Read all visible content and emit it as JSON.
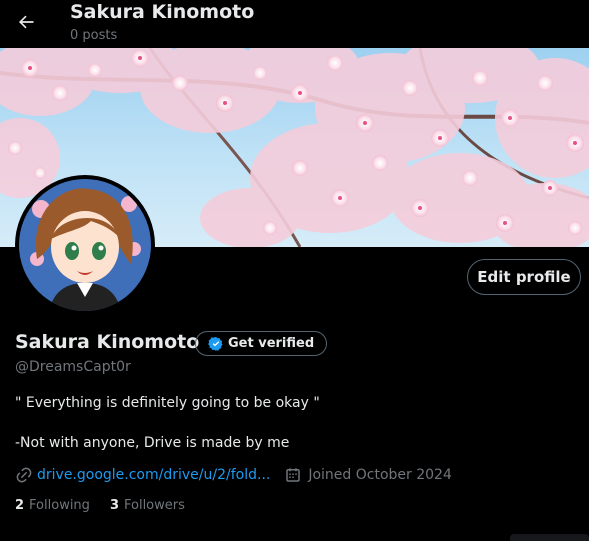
{
  "header": {
    "title": "Sakura Kinomoto",
    "post_count": "0 posts"
  },
  "profile": {
    "display_name": "Sakura Kinomoto",
    "get_verified_label": "Get verified",
    "handle": "@DreamsCapt0r",
    "edit_profile_label": "Edit profile",
    "bio_line1": "\" Everything is definitely going to be okay \"",
    "bio_line2": "-Not with anyone, Drive is made by me",
    "website": "drive.google.com/drive/u/2/fold...",
    "joined": "Joined October 2024",
    "following_count": "2",
    "following_label": "Following",
    "followers_count": "3",
    "followers_label": "Followers"
  },
  "icons": {
    "back": "arrow-left-icon",
    "verified": "verified-badge-icon",
    "link": "link-icon",
    "calendar": "calendar-icon"
  },
  "colors": {
    "background": "#000000",
    "text_primary": "#e7e9ea",
    "text_secondary": "#71767b",
    "accent": "#1d9bf0",
    "border": "#536471"
  }
}
